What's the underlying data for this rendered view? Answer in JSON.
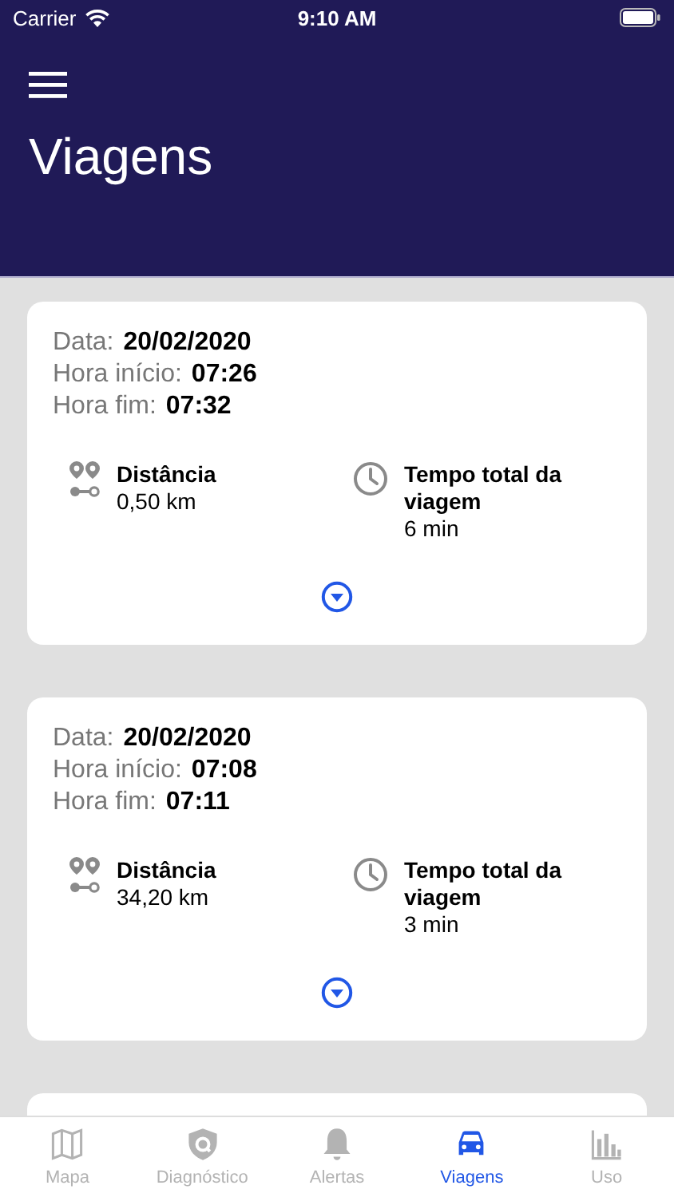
{
  "status_bar": {
    "carrier": "Carrier",
    "time": "9:10 AM"
  },
  "header": {
    "title": "Viagens"
  },
  "trips": [
    {
      "fields": [
        {
          "label": "Data:",
          "value": "20/02/2020"
        },
        {
          "label": "Hora início:",
          "value": "07:26"
        },
        {
          "label": "Hora fim:",
          "value": "07:32"
        }
      ],
      "distance": {
        "label": "Distância",
        "value": "0,50 km"
      },
      "duration": {
        "label": "Tempo total da viagem",
        "value": "6 min"
      },
      "expanded": false
    },
    {
      "fields": [
        {
          "label": "Data:",
          "value": "20/02/2020"
        },
        {
          "label": "Hora início:",
          "value": "07:08"
        },
        {
          "label": "Hora fim:",
          "value": "07:11"
        }
      ],
      "distance": {
        "label": "Distância",
        "value": "34,20 km"
      },
      "duration": {
        "label": "Tempo total da viagem",
        "value": "3 min"
      },
      "expanded": false
    }
  ],
  "tab_bar": [
    {
      "label": "Mapa",
      "selected": false
    },
    {
      "label": "Diagnóstico",
      "selected": false
    },
    {
      "label": "Alertas",
      "selected": false
    },
    {
      "label": "Viagens",
      "selected": true
    },
    {
      "label": "Uso",
      "selected": false
    }
  ]
}
